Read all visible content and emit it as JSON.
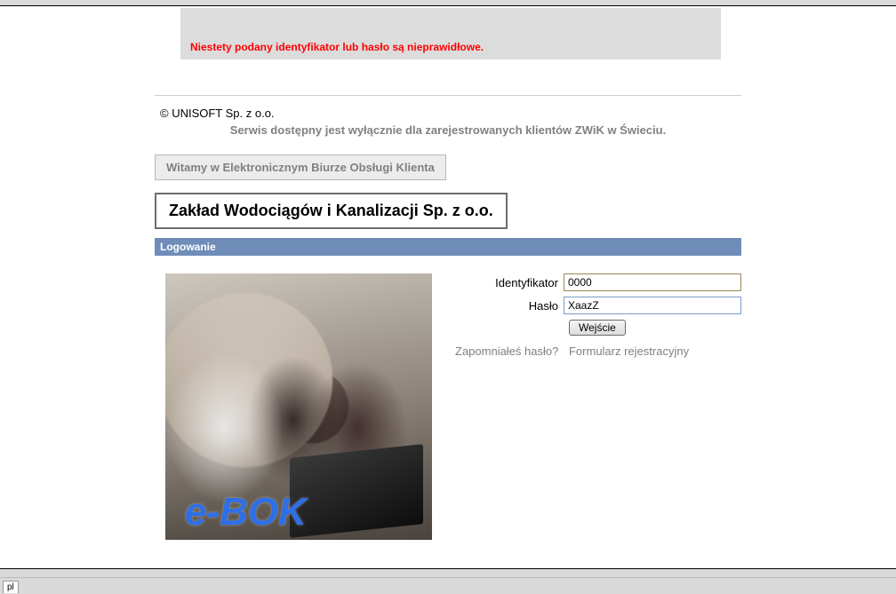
{
  "alert": {
    "message": "Niestety podany identyfikator lub hasło są nieprawidłowe."
  },
  "copyright": "© UNISOFT Sp. z o.o.",
  "availability": "Serwis dostępny jest wyłącznie dla zarejestrowanych klientów ZWiK w Świeciu.",
  "welcome": "Witamy w Elektronicznym Biurze Obsługi Klienta",
  "company": "Zakład Wodociągów i Kanalizacji Sp. z o.o.",
  "section_title": "Logowanie",
  "image_overlay": "e-BOK",
  "form": {
    "id_label": "Identyfikator",
    "id_value": "0000",
    "pw_label": "Hasło",
    "pw_value": "XaazZ",
    "submit": "Wejście"
  },
  "links": {
    "forgot": "Zapomniałeś hasło?",
    "register": "Formularz rejestracyjny"
  },
  "footer": {
    "lang": "pl"
  }
}
